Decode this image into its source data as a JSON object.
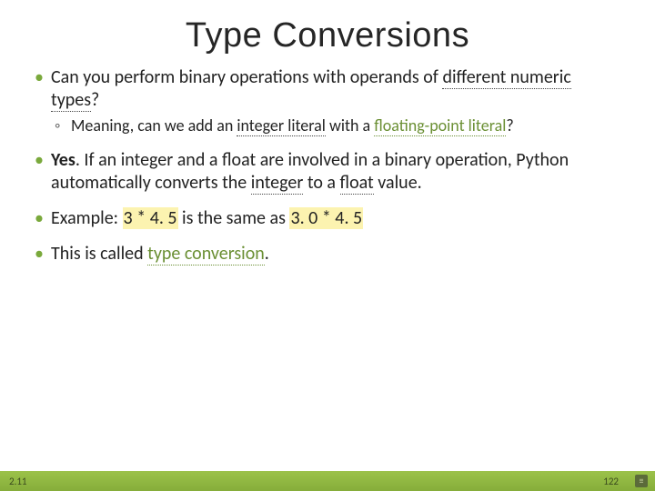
{
  "title": "Type Conversions",
  "bullets": {
    "b1_a": "Can you perform binary operations with operands of ",
    "b1_b": "different numeric types",
    "b1_c": "?",
    "b1_sub_a": "Meaning, can we add an ",
    "b1_sub_b": "integer literal",
    "b1_sub_c": " with a ",
    "b1_sub_d": "floating-point literal",
    "b1_sub_e": "?",
    "b2_a": "Yes",
    "b2_b": ". If an integer and a float are involved in a binary operation, Python automatically converts the ",
    "b2_c": "integer",
    "b2_d": " to a ",
    "b2_e": "float",
    "b2_f": " value.",
    "b3_a": "Example: ",
    "b3_b": "3 * 4. 5",
    "b3_c": " is the same as ",
    "b3_d": "3. 0 * 4. 5",
    "b4_a": "This is called ",
    "b4_b": "type conversion",
    "b4_c": "."
  },
  "footer": {
    "section": "2.11",
    "page": "122"
  }
}
